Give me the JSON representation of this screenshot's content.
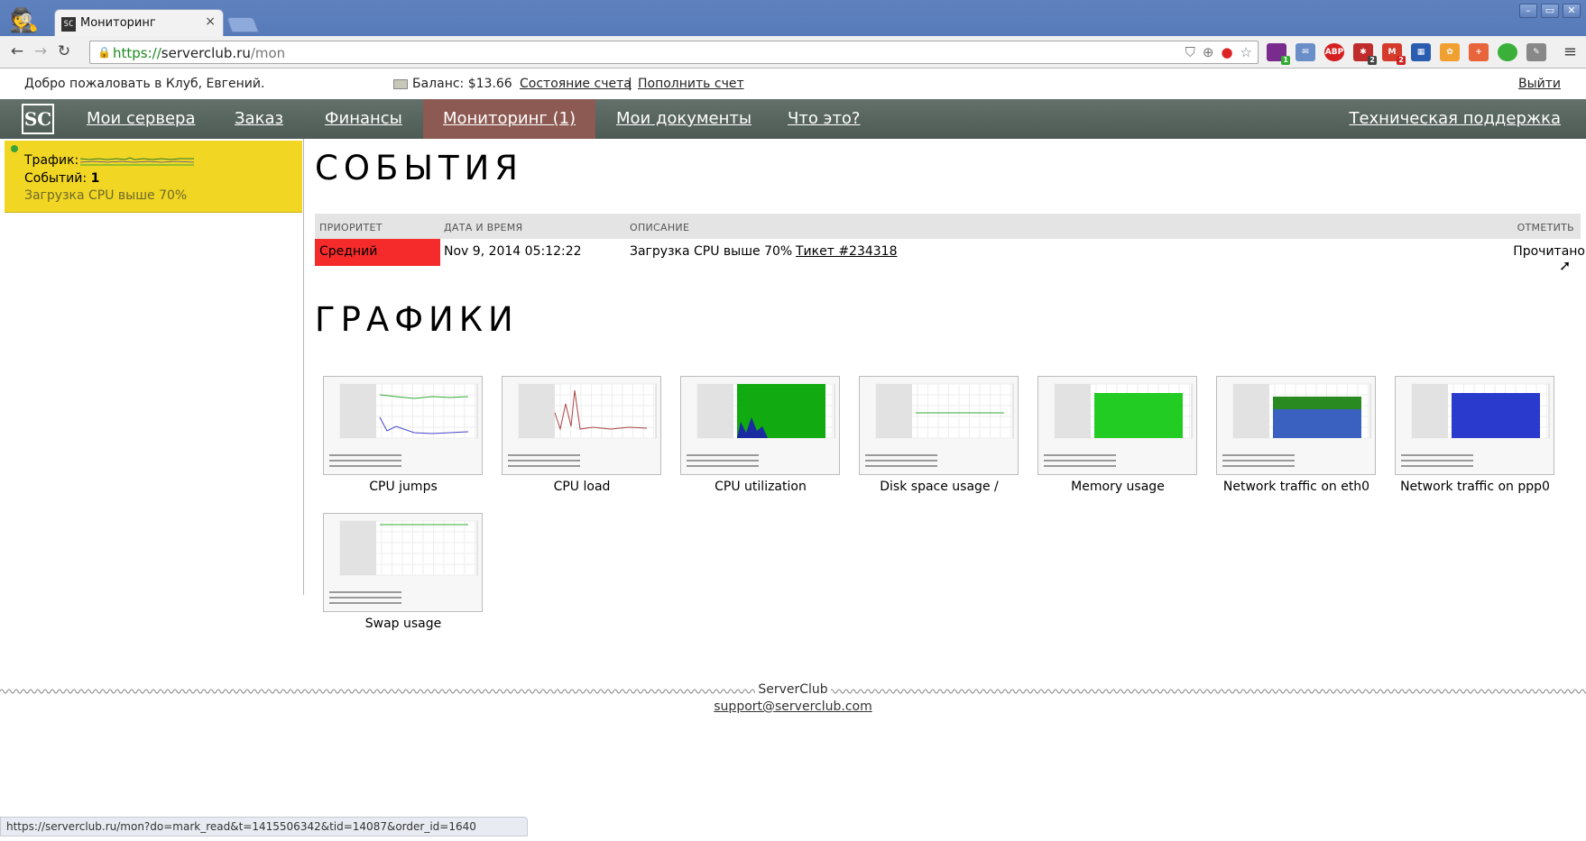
{
  "browser": {
    "tab_title": "Мониторинг",
    "tab_close": "×",
    "url_proto": "https://",
    "url_host": "serverclub.ru",
    "url_path": "/mon",
    "status_url": "https://serverclub.ru/mon?do=mark_read&t=1415506342&tid=14087&order_id=1640",
    "extension_badges": [
      "1",
      "2",
      "2"
    ],
    "ext_abp": "ABP"
  },
  "topbar": {
    "welcome": "Добро пожаловать в Клуб, Евгений.",
    "balance": "Баланс: $13.66",
    "account_state": "Состояние счета",
    "separator": "|",
    "top_up": "Пополнить счет",
    "logout": "Выйти"
  },
  "nav": {
    "logo": "SC",
    "items": [
      "Мои сервера",
      "Заказ",
      "Финансы",
      "Мониторинг (1)",
      "Мои документы",
      "Что это?"
    ],
    "support": "Техническая поддержка"
  },
  "sidebar": {
    "traffic_label": "Трафик:",
    "events_label": "Событий:",
    "events_count": "1",
    "alert": "Загрузка CPU выше 70%"
  },
  "events": {
    "heading": "СОБЫТИЯ",
    "columns": [
      "ПРИОРИТЕТ",
      "ДАТА И ВРЕМЯ",
      "ОПИСАНИЕ",
      "ОТМЕТИТЬ"
    ],
    "row": {
      "priority": "Средний",
      "datetime": "Nov 9, 2014 05:12:22",
      "description": "Загрузка CPU выше 70%",
      "ticket": "Тикет #234318",
      "action": "Прочитано"
    }
  },
  "graphs": {
    "heading": "ГРАФИКИ",
    "items": [
      "CPU jumps",
      "CPU load",
      "CPU utilization",
      "Disk space usage /",
      "Memory usage",
      "Network traffic on eth0",
      "Network traffic on ppp0",
      "Swap usage"
    ]
  },
  "footer": {
    "name": "ServerClub",
    "email": "support@serverclub.com"
  }
}
